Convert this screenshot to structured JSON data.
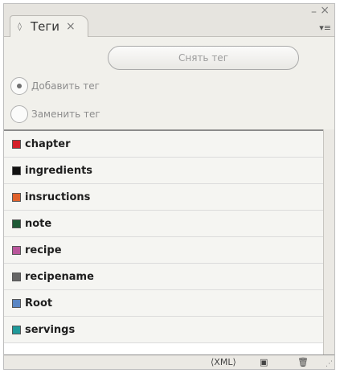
{
  "window": {
    "minimize_glyph": "–",
    "close_glyph": "×"
  },
  "tab": {
    "title": "Теги",
    "close_glyph": "×",
    "diamond": "◊"
  },
  "panel_menu_glyph": "▾≡",
  "untag_button": {
    "label": "Снять тег"
  },
  "radios": [
    {
      "label": "Добавить тег",
      "selected": true
    },
    {
      "label": "Заменить тег",
      "selected": false
    }
  ],
  "tags": [
    {
      "name": "chapter",
      "color": "#d4202a"
    },
    {
      "name": "ingredients",
      "color": "#111111"
    },
    {
      "name": "insructions",
      "color": "#e0612b"
    },
    {
      "name": "note",
      "color": "#1e5a36"
    },
    {
      "name": "recipe",
      "color": "#b9569b"
    },
    {
      "name": "recipename",
      "color": "#666666"
    },
    {
      "name": "Root",
      "color": "#5a86c4"
    },
    {
      "name": "servings",
      "color": "#1f9a9a"
    }
  ],
  "bottom_icons": {
    "autotag": "⟨XML⟩",
    "new_tag": "▣",
    "delete": "🗑"
  }
}
